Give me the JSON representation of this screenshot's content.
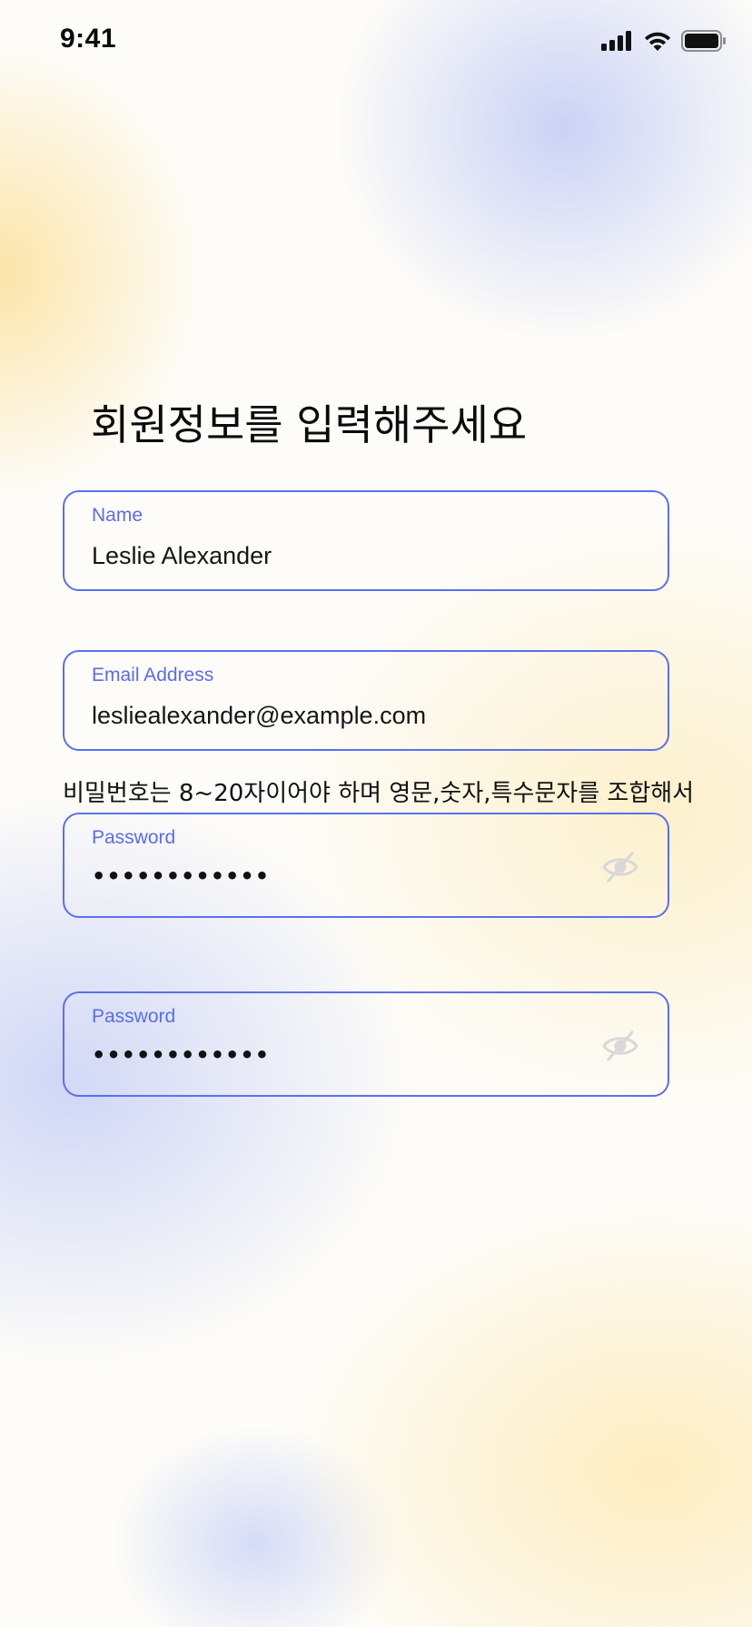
{
  "status_bar": {
    "time": "9:41",
    "icons": [
      "signal-icon",
      "wifi-icon",
      "battery-icon"
    ]
  },
  "title": "회원정보를 입력해주세요",
  "fields": {
    "name": {
      "label": "Name",
      "value": "Leslie Alexander"
    },
    "email": {
      "label": "Email Address",
      "value": "lesliealexander@example.com"
    },
    "password_hint": "비밀번호는 8~20자이어야 하며 영문,숫자,특수문자를 조합해서",
    "password": {
      "label": "Password",
      "masked_value": "••••••••••••",
      "visibility_icon": "eye-off-icon"
    },
    "password_confirm": {
      "label": "Password",
      "masked_value": "••••••••••••",
      "visibility_icon": "eye-off-icon"
    }
  },
  "colors": {
    "accent": "#5b6ff0",
    "label": "#5a6cf0",
    "text": "#161616"
  }
}
